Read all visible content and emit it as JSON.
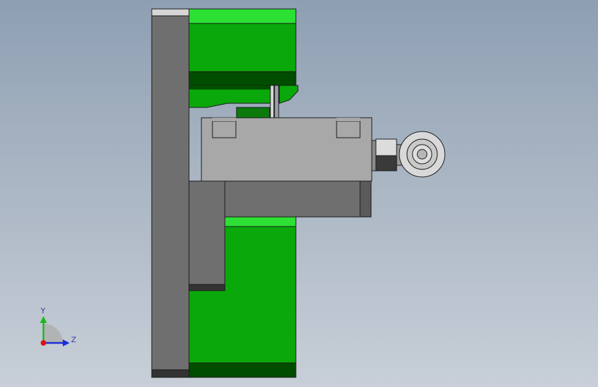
{
  "viewport": {
    "background_top": "#8e9fb3",
    "background_bottom": "#c8cfd8"
  },
  "model": {
    "colors": {
      "green_light": "#2de034",
      "green": "#0aa80a",
      "green_dark": "#004d00",
      "gray_plate": "#6f6f6f",
      "gray_block": "#a8a8a8",
      "gray_dark": "#3a3a3a",
      "outline": "#1a1a1a"
    }
  },
  "triad": {
    "y_label": "Y",
    "z_label": "Z",
    "y_color": "#1db81d",
    "z_color": "#1a2fd6",
    "x_color": "#e01010"
  }
}
